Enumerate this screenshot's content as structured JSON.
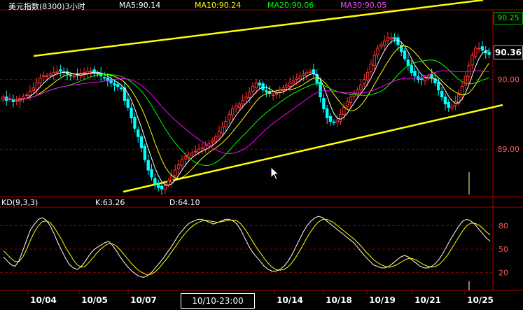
{
  "header": {
    "title": "美元指数(8300)3小时",
    "ma5": "MA5:90.14",
    "ma10": "MA10:90.24",
    "ma20": "MA20:90.06",
    "ma30": "MA30:90.05",
    "kd_label": "KD(9,3,3)",
    "k_value": "K:63.26",
    "d_value": "D:64.10"
  },
  "price_box": "90.36",
  "top_box": "90.25",
  "cursor_date": "10/10-23:00",
  "colors": {
    "background": "#000000",
    "up_candle": "#ff3333",
    "down_candle": "#00ffff",
    "ma5": "#ffffff",
    "ma10": "#ffff00",
    "ma20": "#00ff00",
    "ma30": "#ff00ff",
    "trendline": "#ffff00",
    "grid": "#8b0000",
    "axis_text": "#ff5555"
  },
  "chart_data": [
    {
      "type": "candlestick",
      "title": "美元指数(8300)3小时",
      "ylim": [
        88.35,
        91.0
      ],
      "y_ticks": [
        "90.00",
        "89.00"
      ],
      "x_ticks": [
        "10/04",
        "10/05",
        "10/07",
        "10/14",
        "10/18",
        "10/19",
        "10/21",
        "10/25"
      ],
      "legend": [
        "MA5:90.14",
        "MA10:90.24",
        "MA20:90.06",
        "MA30:90.05"
      ],
      "close": [
        89.75,
        89.7,
        89.72,
        89.68,
        89.7,
        89.73,
        89.75,
        89.78,
        89.83,
        89.88,
        89.95,
        90.02,
        90.06,
        90.05,
        90.08,
        90.1,
        90.12,
        90.12,
        90.1,
        90.08,
        90.05,
        90.05,
        90.06,
        90.08,
        90.1,
        90.12,
        90.12,
        90.1,
        90.08,
        90.05,
        90.02,
        89.98,
        89.95,
        89.92,
        89.9,
        89.88,
        89.7,
        89.6,
        89.45,
        89.3,
        89.18,
        89.02,
        88.85,
        88.7,
        88.6,
        88.5,
        88.45,
        88.43,
        88.48,
        88.55,
        88.62,
        88.7,
        88.78,
        88.85,
        88.9,
        88.92,
        88.95,
        88.97,
        89.0,
        89.02,
        89.05,
        89.08,
        89.12,
        89.18,
        89.25,
        89.32,
        89.4,
        89.5,
        89.58,
        89.62,
        89.65,
        89.7,
        89.75,
        89.82,
        89.9,
        89.95,
        89.92,
        89.85,
        89.82,
        89.8,
        89.78,
        89.8,
        89.85,
        89.88,
        89.92,
        89.95,
        89.98,
        90.02,
        90.05,
        90.08,
        90.1,
        90.12,
        90.08,
        89.95,
        89.75,
        89.58,
        89.45,
        89.4,
        89.38,
        89.42,
        89.5,
        89.6,
        89.68,
        89.75,
        89.8,
        89.85,
        89.92,
        90.0,
        90.1,
        90.22,
        90.35,
        90.45,
        90.5,
        90.55,
        90.6,
        90.6,
        90.58,
        90.5,
        90.4,
        90.3,
        90.2,
        90.1,
        90.05,
        90.0,
        90.0,
        90.02,
        90.05,
        90.02,
        89.95,
        89.85,
        89.75,
        89.65,
        89.6,
        89.62,
        89.68,
        89.78,
        89.9,
        90.05,
        90.2,
        90.35,
        90.45,
        90.45,
        90.42,
        90.38,
        90.36
      ],
      "kd": {
        "ylim": [
          0,
          100
        ],
        "y_ticks": [
          80,
          50,
          20
        ],
        "legend": [
          "K:63.26",
          "D:64.10"
        ],
        "k": [
          40,
          35,
          30,
          28,
          35,
          48,
          62,
          75,
          82,
          88,
          90,
          87,
          80,
          70,
          58,
          48,
          38,
          30,
          26,
          24,
          28,
          34,
          42,
          48,
          52,
          55,
          58,
          60,
          55,
          48,
          40,
          33,
          27,
          22,
          18,
          15,
          14,
          16,
          20,
          26,
          32,
          38,
          45,
          52,
          60,
          68,
          74,
          80,
          84,
          86,
          88,
          88,
          86,
          84,
          82,
          84,
          86,
          88,
          88,
          86,
          82,
          74,
          64,
          54,
          46,
          40,
          34,
          28,
          24,
          22,
          22,
          24,
          28,
          34,
          42,
          52,
          62,
          72,
          80,
          86,
          90,
          92,
          90,
          86,
          82,
          78,
          74,
          70,
          66,
          62,
          58,
          52,
          46,
          40,
          35,
          30,
          28,
          26,
          26,
          28,
          32,
          36,
          40,
          42,
          40,
          36,
          32,
          28,
          26,
          26,
          28,
          32,
          38,
          46,
          55,
          64,
          72,
          80,
          86,
          88,
          86,
          82,
          76,
          70,
          64,
          60
        ],
        "d": [
          48,
          43,
          38,
          34,
          34,
          40,
          50,
          62,
          72,
          80,
          85,
          86,
          84,
          78,
          70,
          62,
          52,
          44,
          36,
          30,
          27,
          28,
          33,
          39,
          45,
          50,
          54,
          57,
          57,
          54,
          49,
          43,
          37,
          31,
          26,
          22,
          19,
          17,
          18,
          21,
          26,
          32,
          38,
          45,
          52,
          59,
          66,
          72,
          77,
          81,
          84,
          86,
          87,
          86,
          85,
          84,
          85,
          86,
          87,
          87,
          86,
          82,
          76,
          68,
          60,
          52,
          45,
          38,
          32,
          27,
          24,
          23,
          24,
          27,
          32,
          39,
          47,
          56,
          65,
          73,
          80,
          85,
          88,
          88,
          86,
          83,
          79,
          75,
          71,
          67,
          63,
          58,
          53,
          47,
          42,
          37,
          33,
          30,
          28,
          27,
          28,
          30,
          33,
          36,
          38,
          38,
          36,
          33,
          30,
          28,
          27,
          28,
          31,
          36,
          42,
          50,
          58,
          66,
          74,
          80,
          83,
          83,
          81,
          77,
          72,
          68
        ]
      }
    }
  ]
}
